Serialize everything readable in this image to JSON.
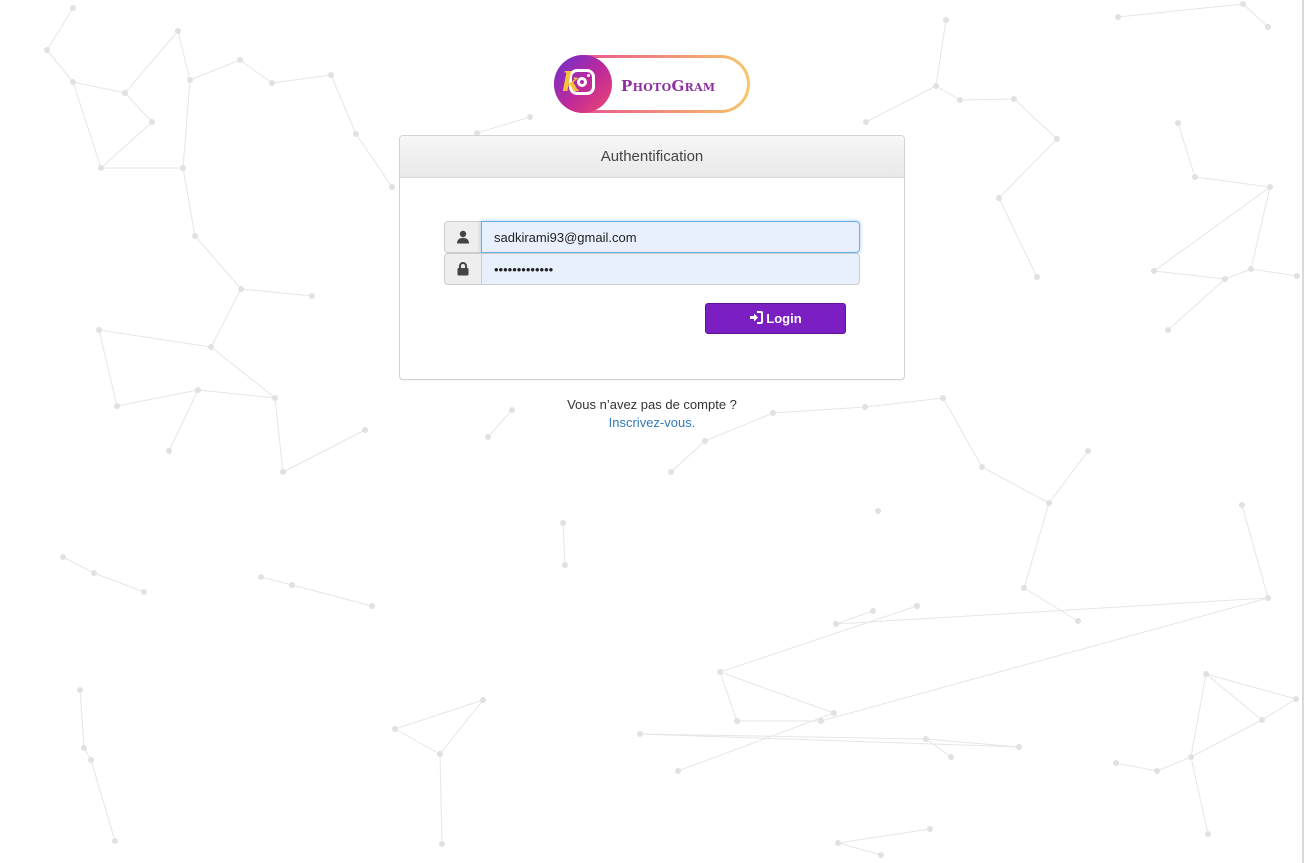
{
  "brand": {
    "logo_text": "PhotoGram"
  },
  "panel": {
    "title": "Authentification"
  },
  "form": {
    "email_value": "sadkirami93@gmail.com",
    "password_value": "•••••••••••••",
    "login_label": "Login"
  },
  "signup": {
    "question": "Vous n’avez pas de compte ?",
    "link_label": "Inscrivez-vous."
  },
  "icons": {
    "user": "user-icon",
    "lock": "lock-icon",
    "login": "login-icon"
  },
  "colors": {
    "accent": "#7b1fc2",
    "link": "#337ab7",
    "autofill": "#e8f0fe"
  }
}
